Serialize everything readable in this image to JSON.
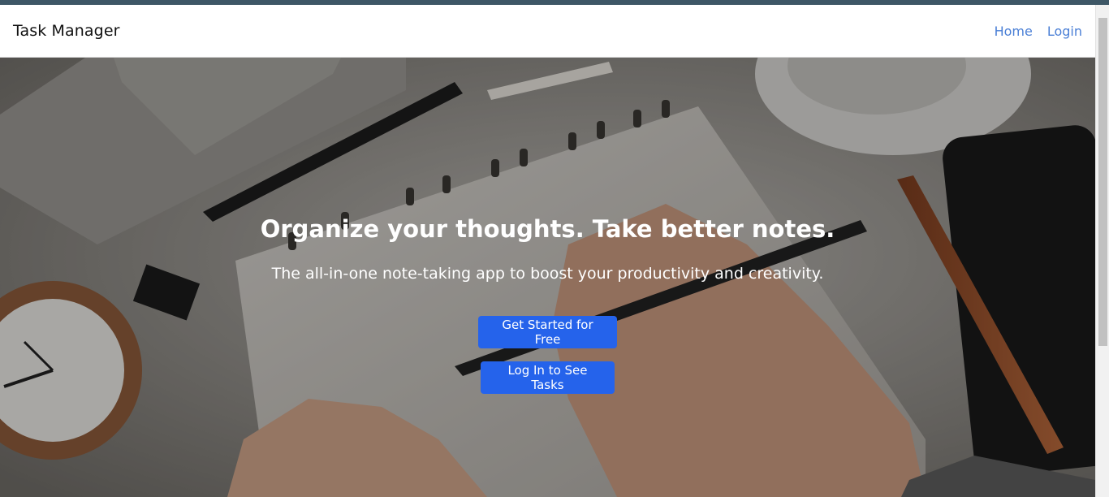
{
  "navbar": {
    "brand": "Task Manager",
    "links": [
      {
        "label": "Home"
      },
      {
        "label": "Login"
      }
    ]
  },
  "hero": {
    "title": "Organize your thoughts. Take better notes.",
    "subtitle": "The all-in-one note-taking app to boost your productivity and creativity.",
    "primary_button": "Get Started for Free",
    "secondary_button": "Log In to See Tasks",
    "background_image": "desk-notebook-writing-photo"
  },
  "colors": {
    "accent": "#2563eb",
    "nav_link": "#4a7fd6",
    "top_strip": "#3e5766"
  }
}
